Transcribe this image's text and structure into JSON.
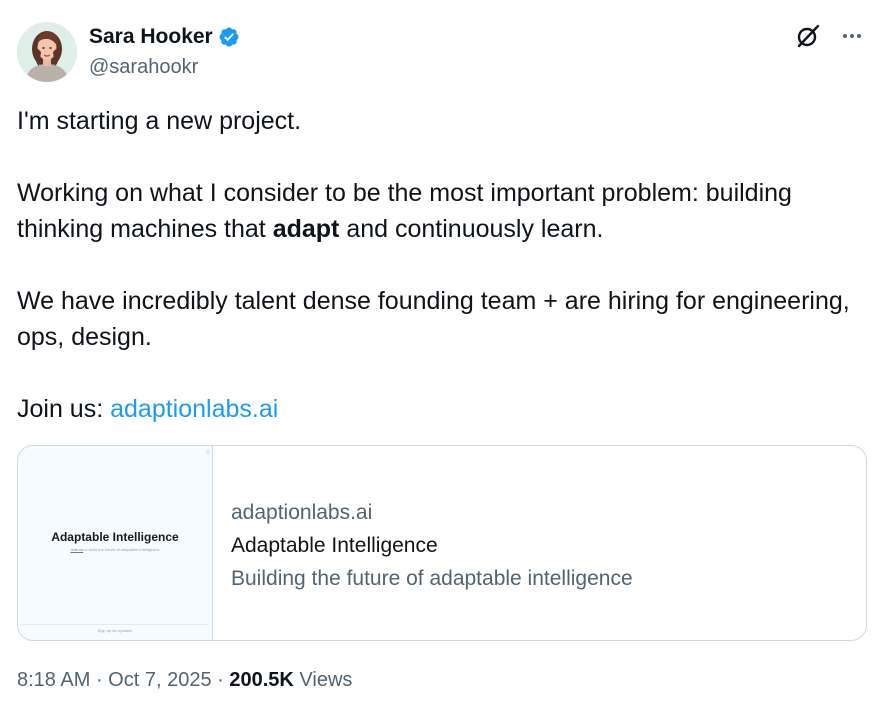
{
  "author": {
    "name": "Sara Hooker",
    "handle": "@sarahookr",
    "verified_color": "#1d9bf0"
  },
  "header_actions": {
    "icons": [
      "grok-icon",
      "more-icon"
    ]
  },
  "tweet": {
    "para1": "I'm starting a new project.",
    "para2_before": "Working on what I consider to be the most important problem: building thinking machines that ",
    "para2_bold": "adapt",
    "para2_after": " and continuously learn.",
    "para3": "We have incredibly talent dense founding team + are hiring for engineering, ops, design.",
    "para4_prefix": "Join us: ",
    "para4_link": "adaptionlabs.ai"
  },
  "link_card": {
    "thumbnail": {
      "title": "Adaptable Intelligence",
      "subtitle_link": "Join us",
      "subtitle_rest": " to build the future of adaptable intelligence",
      "footer": "Sign up for updates",
      "corner_mark": "☰"
    },
    "domain": "adaptionlabs.ai",
    "title": "Adaptable Intelligence",
    "description": "Building the future of adaptable intelligence"
  },
  "meta": {
    "time": "8:18 AM",
    "sep1": " · ",
    "date": "Oct 7, 2025",
    "sep2": " · ",
    "views_count": "200.5K",
    "views_label": " Views"
  },
  "colors": {
    "link": "#1d9bf0",
    "secondary_text": "#536471",
    "primary_text": "#0f1419",
    "border": "#cfd9de"
  }
}
